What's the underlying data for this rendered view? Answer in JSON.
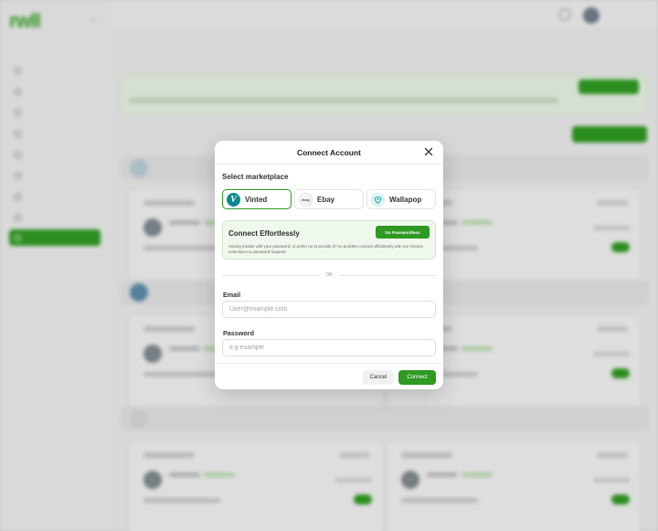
{
  "modal": {
    "title": "Connect Account",
    "close_icon": "close-icon",
    "select_label": "Select marketplace",
    "marketplaces": [
      {
        "name": "Vinted",
        "icon": "vinted-logo",
        "selected": true
      },
      {
        "name": "Ebay",
        "icon": "ebay-logo",
        "selected": false
      },
      {
        "name": "Wallapop",
        "icon": "wallapop-logo",
        "selected": false
      }
    ],
    "promo": {
      "title": "Connect Effortlessly",
      "button": "Go Passwordless",
      "description": "Having trouble with your password, or prefer no to provide it? no problem connect effortlessly with our chrome extension-no password required."
    },
    "divider_text": "OR",
    "email": {
      "label": "Email",
      "placeholder": "User@example.com",
      "value": ""
    },
    "password": {
      "label": "Password",
      "placeholder": "e.g example",
      "value": ""
    },
    "cancel_label": "Cancel",
    "connect_label": "Connect"
  },
  "colors": {
    "accent": "#2e9a21",
    "promo_bg": "#eff8ec",
    "vinted": "#0a8a8f"
  }
}
